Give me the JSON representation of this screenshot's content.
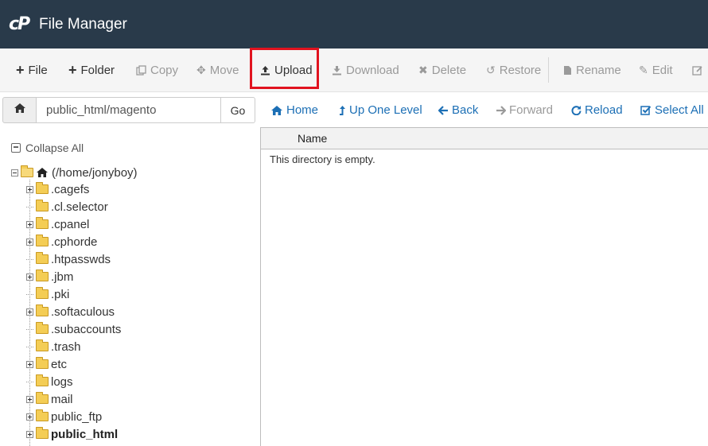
{
  "header": {
    "logo": "cP",
    "title": "File Manager"
  },
  "toolbar": {
    "items": [
      {
        "label": "File",
        "icon": "plus-icon",
        "enabled": true
      },
      {
        "label": "Folder",
        "icon": "plus-icon",
        "enabled": true
      },
      {
        "label": "Copy",
        "icon": "copy-icon",
        "enabled": false
      },
      {
        "label": "Move",
        "icon": "move-icon",
        "enabled": false
      },
      {
        "label": "Upload",
        "icon": "upload-icon",
        "enabled": true,
        "highlighted": true
      },
      {
        "label": "Download",
        "icon": "download-icon",
        "enabled": false
      },
      {
        "label": "Delete",
        "icon": "close-icon",
        "enabled": false
      },
      {
        "label": "Restore",
        "icon": "restore-icon",
        "enabled": false
      },
      {
        "label": "Rename",
        "icon": "file-icon",
        "enabled": false
      },
      {
        "label": "Edit",
        "icon": "pencil-icon",
        "enabled": false
      }
    ],
    "highlight_color": "#e1131f"
  },
  "pathbar": {
    "path_value": "public_html/magento",
    "go_label": "Go"
  },
  "nav": {
    "home": "Home",
    "up": "Up One Level",
    "back": "Back",
    "forward": "Forward",
    "reload": "Reload",
    "select_all": "Select All"
  },
  "tree": {
    "collapse_all": "Collapse All",
    "root_label": "(/home/jonyboy)",
    "items": [
      {
        "label": ".cagefs",
        "expandable": true
      },
      {
        "label": ".cl.selector",
        "expandable": false
      },
      {
        "label": ".cpanel",
        "expandable": true
      },
      {
        "label": ".cphorde",
        "expandable": true
      },
      {
        "label": ".htpasswds",
        "expandable": false
      },
      {
        "label": ".jbm",
        "expandable": true
      },
      {
        "label": ".pki",
        "expandable": false
      },
      {
        "label": ".softaculous",
        "expandable": true
      },
      {
        "label": ".subaccounts",
        "expandable": false
      },
      {
        "label": ".trash",
        "expandable": false
      },
      {
        "label": "etc",
        "expandable": true
      },
      {
        "label": "logs",
        "expandable": false
      },
      {
        "label": "mail",
        "expandable": true
      },
      {
        "label": "public_ftp",
        "expandable": true
      },
      {
        "label": "public_html",
        "expandable": true,
        "bold": true
      }
    ]
  },
  "files": {
    "column_name": "Name",
    "empty_message": "This directory is empty."
  },
  "colors": {
    "header_bg": "#293a4a",
    "link": "#1c6fb5",
    "folder": "#f4cd55"
  }
}
